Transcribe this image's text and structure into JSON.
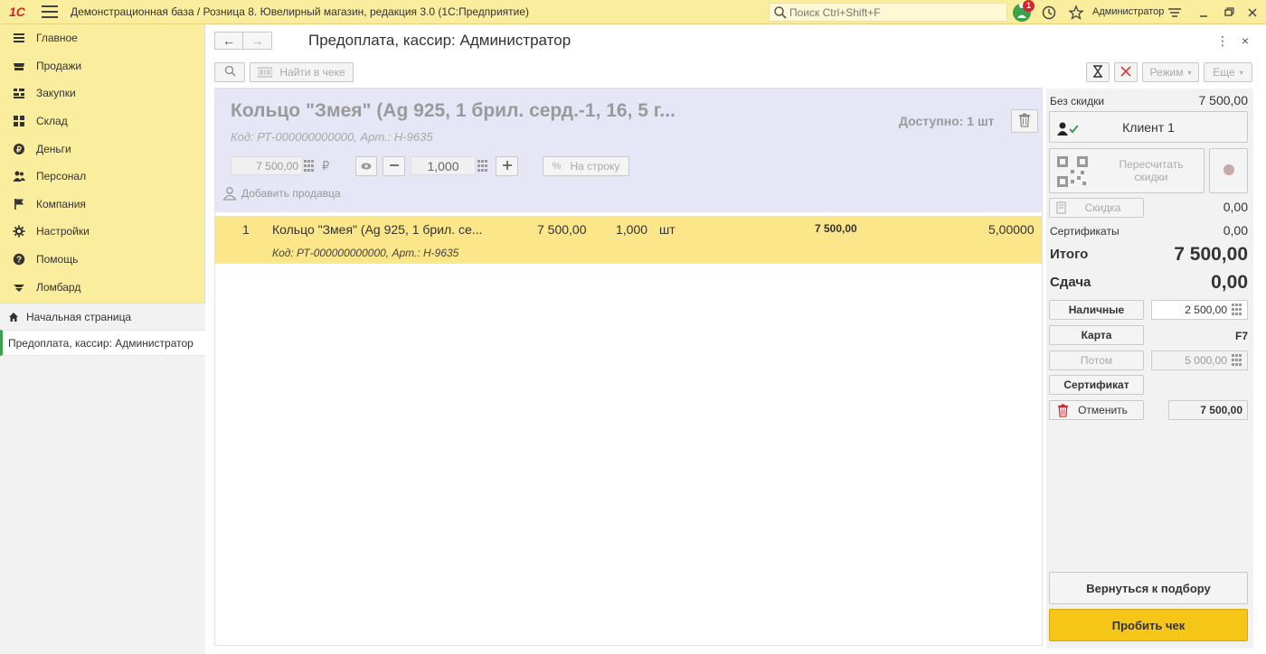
{
  "app": {
    "logo": "1С",
    "title": "Демонстрационная база / Розница 8. Ювелирный магазин, редакция 3.0  (1С:Предприятие)",
    "search_placeholder": "Поиск Ctrl+Shift+F",
    "notifications_count": "1",
    "user": "Администратор"
  },
  "sidebar": {
    "items": [
      {
        "label": "Главное",
        "icon": "menu-lines-icon"
      },
      {
        "label": "Продажи",
        "icon": "cart-icon"
      },
      {
        "label": "Закупки",
        "icon": "purchases-icon"
      },
      {
        "label": "Склад",
        "icon": "warehouse-icon"
      },
      {
        "label": "Деньги",
        "icon": "money-icon"
      },
      {
        "label": "Персонал",
        "icon": "people-icon"
      },
      {
        "label": "Компания",
        "icon": "flag-icon"
      },
      {
        "label": "Настройки",
        "icon": "gear-icon"
      },
      {
        "label": "Помощь",
        "icon": "help-icon"
      },
      {
        "label": "Ломбард",
        "icon": "pawnshop-icon"
      }
    ],
    "home": "Начальная страница",
    "open_form": "Предоплата, кассир: Администратор"
  },
  "form": {
    "title": "Предоплата, кассир: Администратор",
    "find_in_receipt": "Найти в чеке",
    "mode": "Режим",
    "more": "Еще"
  },
  "item": {
    "name": "Кольцо \"Змея\" (Ag 925, 1 брил. серд.-1, 16, 5 г...",
    "code": "Код: РТ-000000000000, Арт.: Н-9635",
    "available": "Доступно: 1 шт",
    "price": "7 500,00",
    "currency": "₽",
    "quantity": "1,000",
    "per_line": "На строку",
    "add_seller": "Добавить продавца"
  },
  "rows": [
    {
      "num": "1",
      "name": "Кольцо \"Змея\" (Ag 925, 1 брил. се...",
      "price": "7 500,00",
      "qty": "1,000",
      "unit": "шт",
      "sum": "7 500,00",
      "extra": "5,00000",
      "code": "Код: РТ-000000000000, Арт.: Н-9635"
    }
  ],
  "summary": {
    "no_discount_label": "Без скидки",
    "no_discount_value": "7 500,00",
    "client": "Клиент 1",
    "recalc": "Пересчитать скидки",
    "discount": "Скидка",
    "discount_value": "0,00",
    "certificates_label": "Сертификаты",
    "certificates_value": "0,00",
    "total_label": "Итого",
    "total_value": "7 500,00",
    "change_label": "Сдача",
    "change_value": "0,00",
    "cash": "Наличные",
    "cash_value": "2 500,00",
    "card": "Карта",
    "card_hotkey": "F7",
    "later": "Потом",
    "later_value": "5 000,00",
    "certificate": "Сертификат",
    "cancel": "Отменить",
    "cancel_value": "7 500,00",
    "back_to_selection": "Вернуться к подбору",
    "print_receipt": "Пробить чек"
  },
  "colors": {
    "header_bg": "#fbed9e",
    "row_selected": "#fce68a",
    "item_panel": "#e6e6f6",
    "primary_button": "#f5c518",
    "brand_red": "#d8232a",
    "notif_green": "#3aa04a"
  }
}
